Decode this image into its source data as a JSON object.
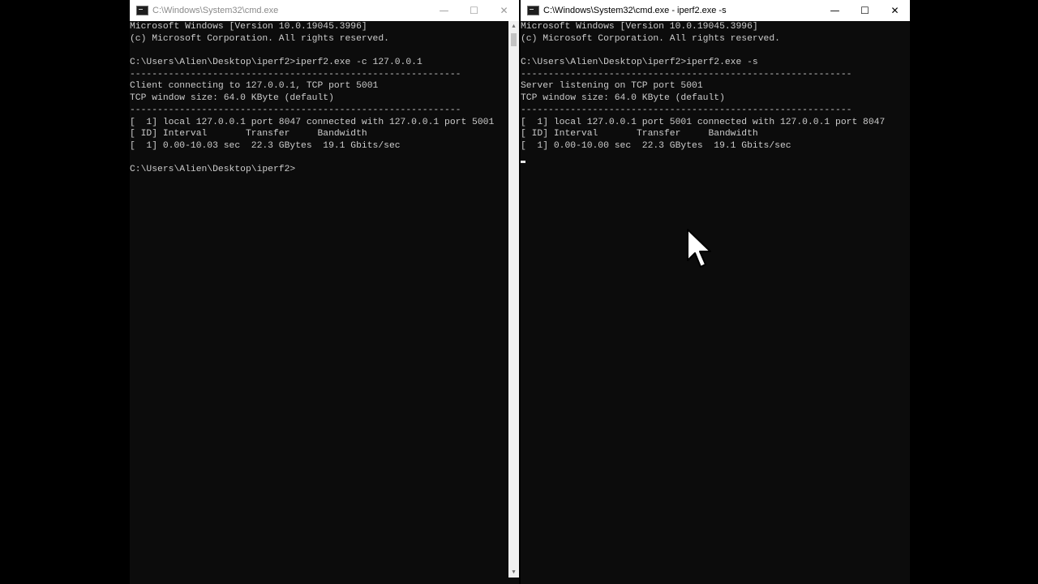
{
  "left_window": {
    "title": "C:\\Windows\\System32\\cmd.exe",
    "lines": [
      "Microsoft Windows [Version 10.0.19045.3996]",
      "(c) Microsoft Corporation. All rights reserved.",
      "",
      "C:\\Users\\Alien\\Desktop\\iperf2>iperf2.exe -c 127.0.0.1",
      "------------------------------------------------------------",
      "Client connecting to 127.0.0.1, TCP port 5001",
      "TCP window size: 64.0 KByte (default)",
      "------------------------------------------------------------",
      "[  1] local 127.0.0.1 port 8047 connected with 127.0.0.1 port 5001",
      "[ ID] Interval       Transfer     Bandwidth",
      "[  1] 0.00-10.03 sec  22.3 GBytes  19.1 Gbits/sec",
      "",
      "C:\\Users\\Alien\\Desktop\\iperf2>"
    ]
  },
  "right_window": {
    "title": "C:\\Windows\\System32\\cmd.exe - iperf2.exe -s",
    "lines": [
      "Microsoft Windows [Version 10.0.19045.3996]",
      "(c) Microsoft Corporation. All rights reserved.",
      "",
      "C:\\Users\\Alien\\Desktop\\iperf2>iperf2.exe -s",
      "------------------------------------------------------------",
      "Server listening on TCP port 5001",
      "TCP window size: 64.0 KByte (default)",
      "------------------------------------------------------------",
      "[  1] local 127.0.0.1 port 5001 connected with 127.0.0.1 port 8047",
      "[ ID] Interval       Transfer     Bandwidth",
      "[  1] 0.00-10.00 sec  22.3 GBytes  19.1 Gbits/sec"
    ]
  },
  "caption_buttons": {
    "minimize": "—",
    "maximize": "☐",
    "close": "✕"
  },
  "icons": {
    "app": "console-app-icon",
    "pointer": "mouse-pointer-icon"
  }
}
